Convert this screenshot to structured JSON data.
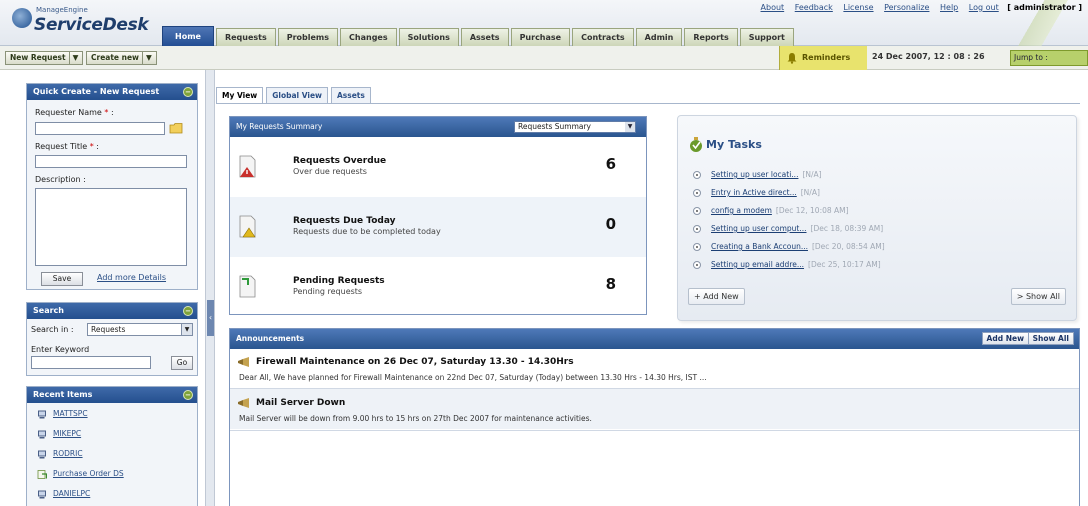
{
  "header": {
    "logo_top": "ManageEngine",
    "logo_main": "ServiceDesk",
    "links": [
      "About",
      "Feedback",
      "License",
      "Personalize",
      "Help",
      "Log out"
    ],
    "user": "[ administrator ]",
    "nav_tabs": [
      "Home",
      "Requests",
      "Problems",
      "Changes",
      "Solutions",
      "Assets",
      "Purchase",
      "Contracts",
      "Admin",
      "Reports",
      "Support"
    ]
  },
  "toolbar": {
    "new_request": "New Request",
    "create_new": "Create new",
    "dd": "▼",
    "reminders": "Reminders",
    "datetime": "24 Dec 2007, 12 : 08 : 26",
    "jump_to": "Jump to :"
  },
  "quick_create": {
    "title": "Quick Create - New Request",
    "requester_label": "Requester Name",
    "request_title_label": "Request Title",
    "required_mark": "*",
    "colon": ":",
    "description_label": "Description :",
    "save": "Save",
    "add_more": "Add more Details"
  },
  "search": {
    "title": "Search",
    "search_in_label": "Search in :",
    "search_in_value": "Requests",
    "keyword_label": "Enter Keyword",
    "go": "Go"
  },
  "recent": {
    "title": "Recent Items",
    "items": [
      "MATTSPC",
      "MIKEPC",
      "RODRIC",
      "Purchase Order DS",
      "DANIELPC"
    ]
  },
  "view_tabs": [
    "My View",
    "Global View",
    "Assets"
  ],
  "summary": {
    "title": "My Requests Summary",
    "select": "Requests Summary",
    "rows": [
      {
        "title": "Requests Overdue",
        "desc": "Over due requests",
        "count": "6"
      },
      {
        "title": "Requests Due Today",
        "desc": "Requests due to be completed today",
        "count": "0"
      },
      {
        "title": "Pending Requests",
        "desc": "Pending requests",
        "count": "8"
      }
    ]
  },
  "tasks": {
    "title": "My Tasks",
    "items": [
      {
        "label": "Setting up user locati...",
        "meta": "[N/A]"
      },
      {
        "label": "Entry in Active direct...",
        "meta": "[N/A]"
      },
      {
        "label": "config a modem",
        "meta": "[Dec 12, 10:08 AM]"
      },
      {
        "label": "Setting up user comput...",
        "meta": "[Dec 18, 08:39 AM]"
      },
      {
        "label": "Creating a Bank Accoun...",
        "meta": "[Dec 20, 08:54 AM]"
      },
      {
        "label": "Setting up email addre...",
        "meta": "[Dec 25, 10:17 AM]"
      }
    ],
    "add_new": "+ Add New",
    "show_all": "> Show All"
  },
  "announcements": {
    "title": "Announcements",
    "add_new": "Add New",
    "show_all": "Show All",
    "items": [
      {
        "title": "Firewall Maintenance on 26 Dec 07, Saturday 13.30 - 14.30Hrs",
        "body": "Dear All, We have planned for Firewall Maintenance on 22nd Dec 07, Saturday (Today) between 13.30 Hrs - 14.30 Hrs, IST ..."
      },
      {
        "title": "Mail Server Down",
        "body": "Mail Server will be down from 9.00 hrs to 15 hrs on 27th Dec 2007 for maintenance activities."
      }
    ]
  },
  "colors": {
    "brand_blue": "#2a558f",
    "nav_active": "#234e93",
    "reminder_yellow": "#e8e36d",
    "link": "#2b4f86",
    "overdue_red": "#c8302c"
  },
  "icons": {
    "logo": "servicedesk-logo",
    "bell": "bell-icon",
    "overdue": "request-overdue-icon",
    "due_today": "request-due-today-icon",
    "pending": "request-pending-icon",
    "tasks": "tasks-icon",
    "announcement": "announcement-icon",
    "workstation": "workstation-icon"
  }
}
